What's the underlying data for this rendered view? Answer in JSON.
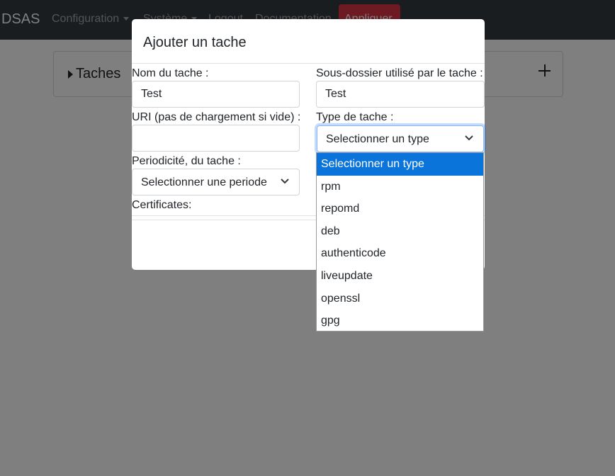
{
  "navbar": {
    "brand": "DSAS",
    "items": [
      "Configuration",
      "Système",
      "Logout",
      "Documentation"
    ],
    "apply_button": "Appliquer"
  },
  "card": {
    "title": "Taches"
  },
  "modal": {
    "title": "Ajouter un tache",
    "fields": {
      "name_label": "Nom du tache :",
      "name_value": "Test",
      "subfolder_label": "Sous-dossier utilisé par le tache :",
      "subfolder_value": "Test",
      "uri_label": "URI (pas de chargement si vide) :",
      "uri_value": "",
      "type_label": "Type de tache :",
      "type_value": "Selectionner un type",
      "period_label": "Periodicité, du tache :",
      "period_value": "Selectionner une periode",
      "cert_label": "Certificates:"
    }
  },
  "dropdown": {
    "options": [
      "Selectionner un type",
      "rpm",
      "repomd",
      "deb",
      "authenticode",
      "liveupdate",
      "openssl",
      "gpg"
    ]
  },
  "colors": {
    "navbar": "#343a40",
    "danger": "#dc3545",
    "selected_option": "#0a74da"
  }
}
